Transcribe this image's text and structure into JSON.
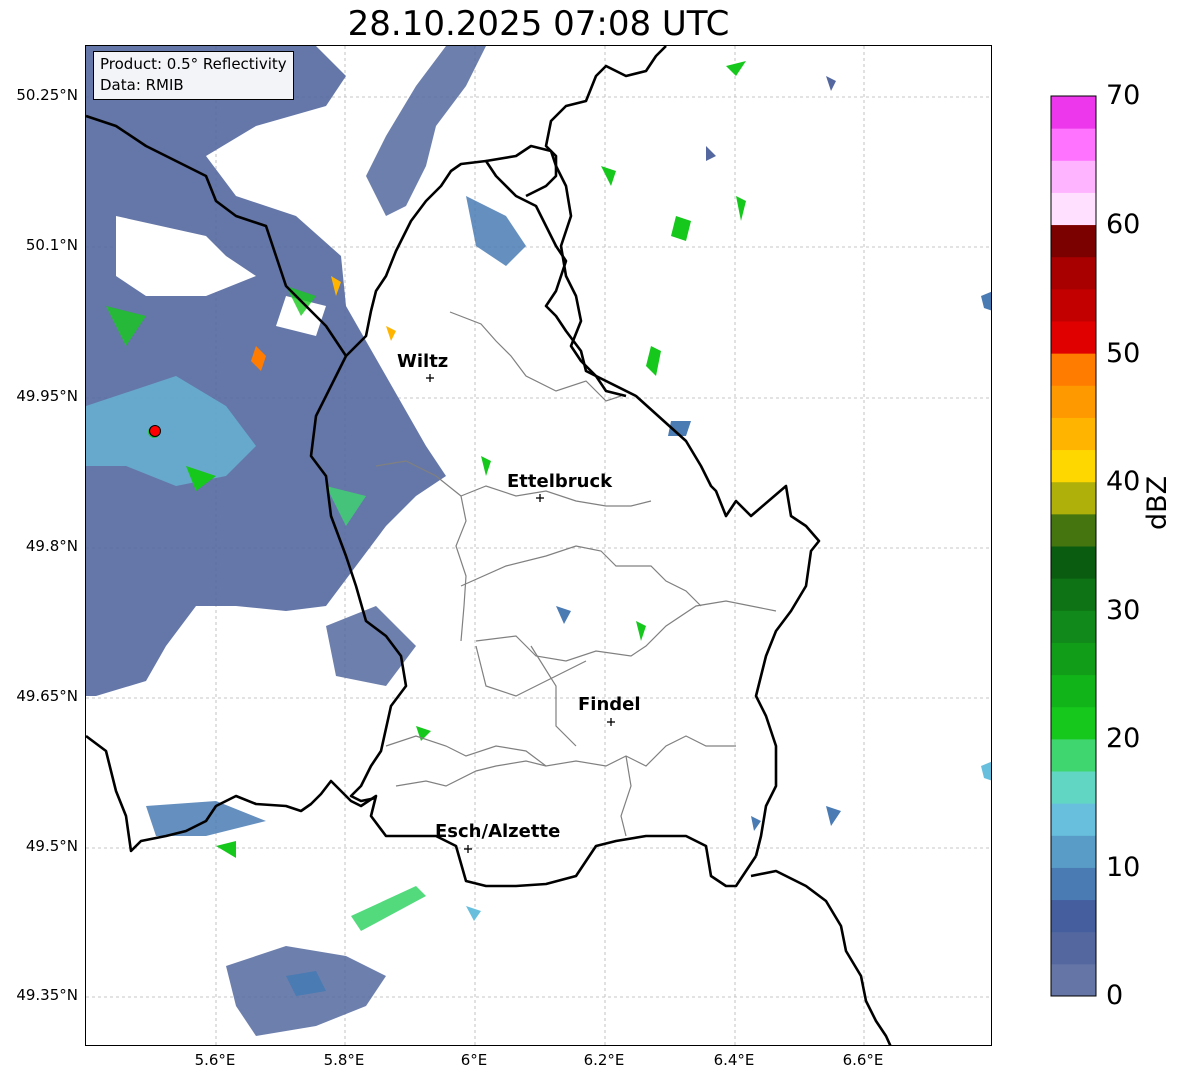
{
  "title": "28.10.2025 07:08 UTC",
  "info": {
    "product": "Product: 0.5° Reflectivity",
    "data_source": "Data: RMIB"
  },
  "lat_labels": [
    "50.25°N",
    "50.1°N",
    "49.95°N",
    "49.8°N",
    "49.65°N",
    "49.5°N",
    "49.35°N"
  ],
  "lon_labels": [
    "5.6°E",
    "5.8°E",
    "6°E",
    "6.2°E",
    "6.4°E",
    "6.6°E"
  ],
  "cities": [
    {
      "name": "Wiltz"
    },
    {
      "name": "Ettelbruck"
    },
    {
      "name": "Findel"
    },
    {
      "name": "Esch/Alzette"
    }
  ],
  "colorbar": {
    "label": "dBZ",
    "ticks": [
      "0",
      "10",
      "20",
      "30",
      "40",
      "50",
      "60",
      "70"
    ],
    "range": [
      0,
      70
    ],
    "step": 2.5,
    "colors": [
      "#6475a6",
      "#54689f",
      "#445e9e",
      "#4a7bb3",
      "#599cc8",
      "#67bfdd",
      "#61d6c3",
      "#3fd66f",
      "#16c81c",
      "#11b419",
      "#119d18",
      "#12891b",
      "#0d7314",
      "#0a5c10",
      "#44750f",
      "#b0b00a",
      "#ffd700",
      "#ffb500",
      "#ff9900",
      "#ff7c00",
      "#e00000",
      "#c30000",
      "#a80000",
      "#7b0000",
      "#ffe1ff",
      "#ffb4ff",
      "#ff73ff",
      "#ec37ec"
    ]
  },
  "radar_site_color": "#ff0000"
}
